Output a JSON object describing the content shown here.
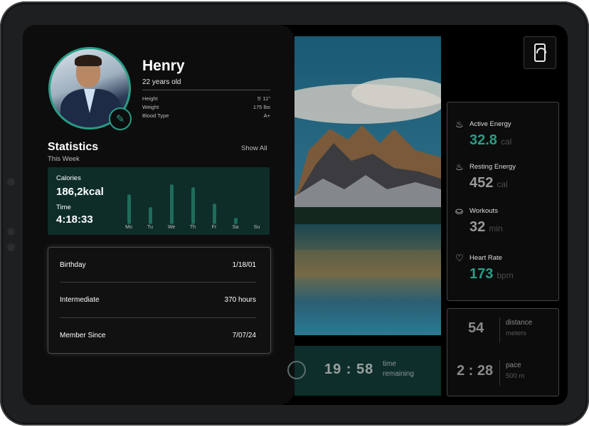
{
  "profile": {
    "name": "Henry",
    "age": "22 years old",
    "info": [
      {
        "label": "Height",
        "value": "5' 11\""
      },
      {
        "label": "Weight",
        "value": "175 lbs"
      },
      {
        "label": "Blood Type",
        "value": "A+"
      }
    ]
  },
  "statistics": {
    "title": "Statistics",
    "subtitle": "This Week",
    "show_all": "Show All",
    "calories_label": "Calories",
    "calories_value": "186,2kcal",
    "time_label": "Time",
    "time_value": "4:18:33",
    "days": [
      "Mo",
      "Tu",
      "We",
      "Th",
      "Fr",
      "Sa",
      "Su"
    ],
    "daily_levels": [
      0.75,
      0.42,
      1.0,
      0.92,
      0.52,
      0.16,
      0.0
    ]
  },
  "details": [
    {
      "label": "Birthday",
      "value": "1/18/01"
    },
    {
      "label": "Intermediate",
      "value": "370 hours"
    },
    {
      "label": "Member Since",
      "value": "7/07/24"
    }
  ],
  "timer": {
    "value": "19 : 58",
    "label_line1": "time",
    "label_line2": "remaining"
  },
  "metrics": [
    {
      "label": "Active Energy",
      "value": "32.8",
      "unit": "cal",
      "icon": "flame-icon",
      "color": "#2a9d86"
    },
    {
      "label": "Resting Energy",
      "value": "452",
      "unit": "cal",
      "icon": "flame-icon",
      "color": "#9a9a9a"
    },
    {
      "label": "Workouts",
      "value": "32",
      "unit": "min",
      "icon": "workout-icon",
      "color": "#9a9a9a"
    },
    {
      "label": "Heart Rate",
      "value": "173",
      "unit": "bpm",
      "icon": "heart-rate-icon",
      "color": "#2a9d86"
    }
  ],
  "distance": {
    "value": "54",
    "label": "distance",
    "unit": "meters"
  },
  "pace": {
    "value": "2 : 28",
    "label": "pace",
    "unit": "500 m"
  },
  "colors": {
    "accent": "#2a9d86",
    "card_green": "#0e2d29",
    "bar": "#1f6c5b"
  }
}
